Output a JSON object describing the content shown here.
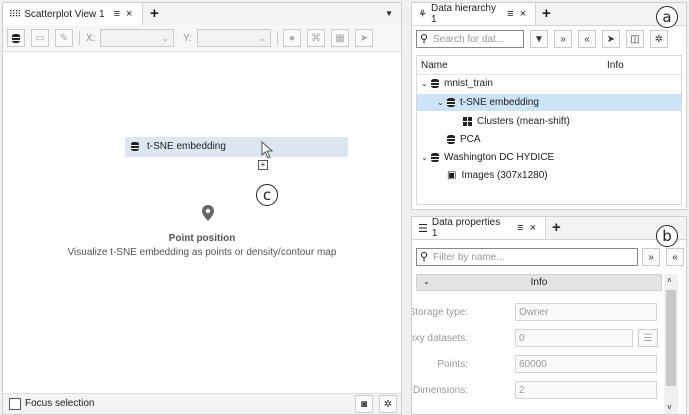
{
  "scatterplot": {
    "tab_title": "Scatterplot View 1",
    "x_label": "X:",
    "y_label": "Y:",
    "drag_item_label": "t-SNE embedding",
    "hint_title": "Point position",
    "hint_text": "Visualize t-SNE embedding as points or density/contour map",
    "focus_label": "Focus selection"
  },
  "hierarchy": {
    "tab_title": "Data hierarchy 1",
    "search_placeholder": "Search for dat...",
    "col_name": "Name",
    "col_info": "Info",
    "items": [
      {
        "label": "mnist_train",
        "level": 0,
        "icon": "database-icon",
        "expanded": true
      },
      {
        "label": "t-SNE embedding",
        "level": 1,
        "icon": "database-icon",
        "expanded": true,
        "selected": true
      },
      {
        "label": "Clusters (mean-shift)",
        "level": 2,
        "icon": "clusters-icon"
      },
      {
        "label": "PCA",
        "level": 1,
        "icon": "database-icon"
      },
      {
        "label": "Washington DC HYDICE",
        "level": 0,
        "icon": "database-icon",
        "expanded": true
      },
      {
        "label": "Images (307x1280)",
        "level": 1,
        "icon": "images-icon"
      }
    ]
  },
  "properties": {
    "tab_title": "Data properties 1",
    "filter_placeholder": "Filter by name...",
    "section_title": "Info",
    "rows": [
      {
        "key": "Storage type:",
        "value": "Owner"
      },
      {
        "key": "Proxy datasets:",
        "value": "0"
      },
      {
        "key": "Points:",
        "value": "60000"
      },
      {
        "key": "Dimensions:",
        "value": "2"
      }
    ]
  },
  "annotations": {
    "a": "a",
    "b": "b",
    "c": "c"
  },
  "colors": {
    "selection": "#cde3f7",
    "drag_highlight": "#dde6f3"
  }
}
